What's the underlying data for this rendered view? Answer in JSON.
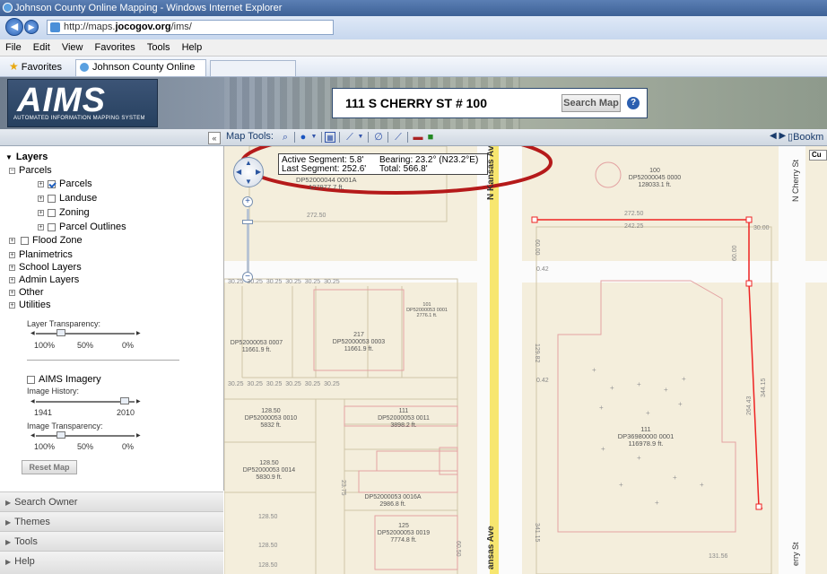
{
  "window": {
    "title": "Johnson County Online Mapping - Windows Internet Explorer"
  },
  "address_bar": {
    "url_prefix": "http://maps.",
    "url_domain": "jocogov.org",
    "url_suffix": "/ims/"
  },
  "menu": [
    "File",
    "Edit",
    "View",
    "Favorites",
    "Tools",
    "Help"
  ],
  "favorites": {
    "label": "Favorites",
    "tab_title": "Johnson County Online Mapping"
  },
  "banner": {
    "logo_text": "AIMS",
    "logo_subtext": "AUTOMATED INFORMATION MAPPING SYSTEM",
    "search_value": "111 S CHERRY ST # 100",
    "search_button": "Search Map",
    "help_glyph": "?"
  },
  "toolbar": {
    "collapse_glyph": "«",
    "map_tools_label": "Map Tools:",
    "bookmarks_label": "Bookm",
    "nav_arrows": "◀ ▶"
  },
  "layers": {
    "heading": "Layers",
    "parcels_group": "Parcels",
    "items": [
      {
        "label": "Parcels",
        "checked": true
      },
      {
        "label": "Landuse",
        "checked": false
      },
      {
        "label": "Zoning",
        "checked": false
      },
      {
        "label": "Parcel Outlines",
        "checked": false
      }
    ],
    "flood_zone": "Flood Zone",
    "groups": [
      "Planimetrics",
      "School Layers",
      "Admin Layers",
      "Other",
      "Utilities"
    ],
    "layer_transparency": {
      "label": "Layer Transparency:",
      "ticks": [
        "100%",
        "50%",
        "0%"
      ],
      "value_percent": 25
    },
    "imagery": {
      "label": "AIMS Imagery",
      "checked": false
    },
    "image_history": {
      "label": "Image History:",
      "ticks": [
        "1941",
        "2010"
      ],
      "value": 2010
    },
    "image_transparency": {
      "label": "Image Transparency:",
      "ticks": [
        "100%",
        "50%",
        "0%"
      ],
      "value_percent": 25
    },
    "reset_button": "Reset Map"
  },
  "sections": [
    "Search Owner",
    "Themes",
    "Tools",
    "Help"
  ],
  "measure": {
    "active_segment": "Active Segment: 5.8'",
    "bearing": "Bearing: 23.2° (N23.2°E)",
    "last_segment": "Last Segment: 252.6'",
    "total": "Total: 566.8'"
  },
  "map": {
    "streets": {
      "kansas": "N Kansas Ave",
      "kansas_bottom": "ansas Ave",
      "cherry": "N Cherry St",
      "cherry_bottom": "erry St",
      "cu_label": "Cu"
    },
    "parcels": [
      {
        "num": "",
        "id": "DP52000044 0001A",
        "area": "127977.7 ft."
      },
      {
        "num": "100",
        "id": "DP52000045 0000",
        "area": "128033.1 ft."
      },
      {
        "num": "111",
        "id": "DP36980000 0001",
        "area": "116978.9 ft."
      },
      {
        "num": "",
        "id": "DP52000053 0007",
        "area": "11661.9 ft."
      },
      {
        "num": "217",
        "id": "DP52000053 0003",
        "area": "11661.9 ft."
      },
      {
        "num": "101",
        "id": "DP52000053 0001",
        "area": "2776.1 ft."
      },
      {
        "num": "128.50",
        "id": "DP52000053 0010",
        "area": "5832 ft."
      },
      {
        "num": "111",
        "id": "DP52000053 0011",
        "area": "3898.2 ft."
      },
      {
        "num": "128.50",
        "id": "DP52000053 0014",
        "area": "5830.9 ft."
      },
      {
        "num": "",
        "id": "DP52000053 0016A",
        "area": "2986.8 ft."
      },
      {
        "num": "125",
        "id": "DP52000053 0019",
        "area": "7774.8 ft."
      }
    ],
    "dims": [
      "272.50",
      "242.25",
      "30.00",
      "60.00",
      "0.42",
      "344.15",
      "264.43",
      "341.15",
      "131.56",
      "129.82",
      "30.25",
      "128.50",
      "60.50",
      "23.75"
    ]
  }
}
